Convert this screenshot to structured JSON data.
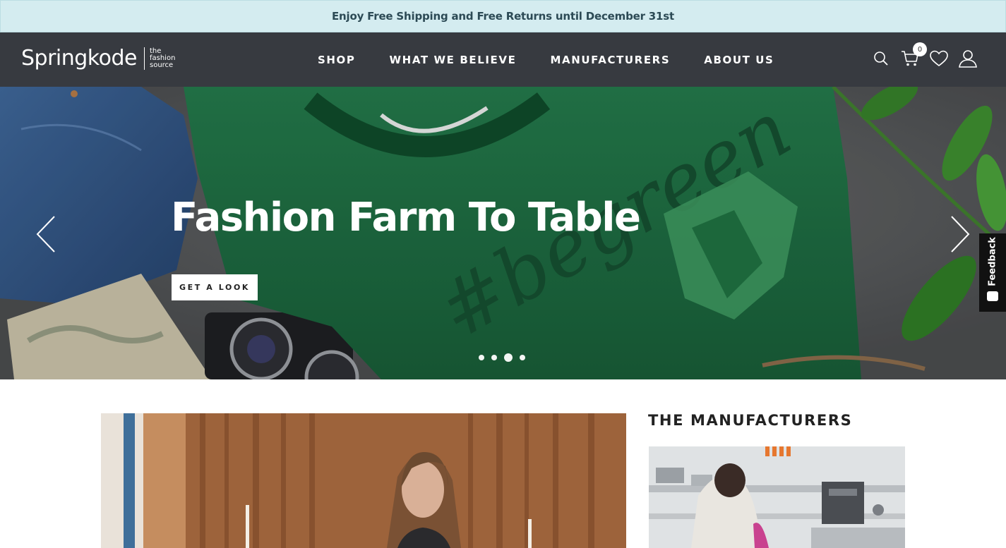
{
  "promo": {
    "text": "Enjoy Free Shipping and Free Returns until December 31st"
  },
  "header": {
    "logo": {
      "wordmark": "Springkode",
      "tagline": [
        "the",
        "fashion",
        "source"
      ]
    },
    "nav": [
      "SHOP",
      "WHAT WE BELIEVE",
      "MANUFACTURERS",
      "ABOUT US"
    ],
    "icons": [
      "search-icon",
      "cart-icon",
      "heart-icon",
      "user-icon"
    ],
    "cart_count": "0"
  },
  "hero": {
    "title": "Fashion Farm To Table",
    "cta": "GET A LOOK",
    "slide_count": 4,
    "active_slide": 3,
    "shirt_text": "#begreen"
  },
  "feedback": {
    "label": "Feedback"
  },
  "manufacturers": {
    "heading": "THE MANUFACTURERS"
  },
  "colors": {
    "promo_bg": "#d4ecf0",
    "header_bg": "#373a40",
    "shirt_green": "#1f6a3f"
  }
}
